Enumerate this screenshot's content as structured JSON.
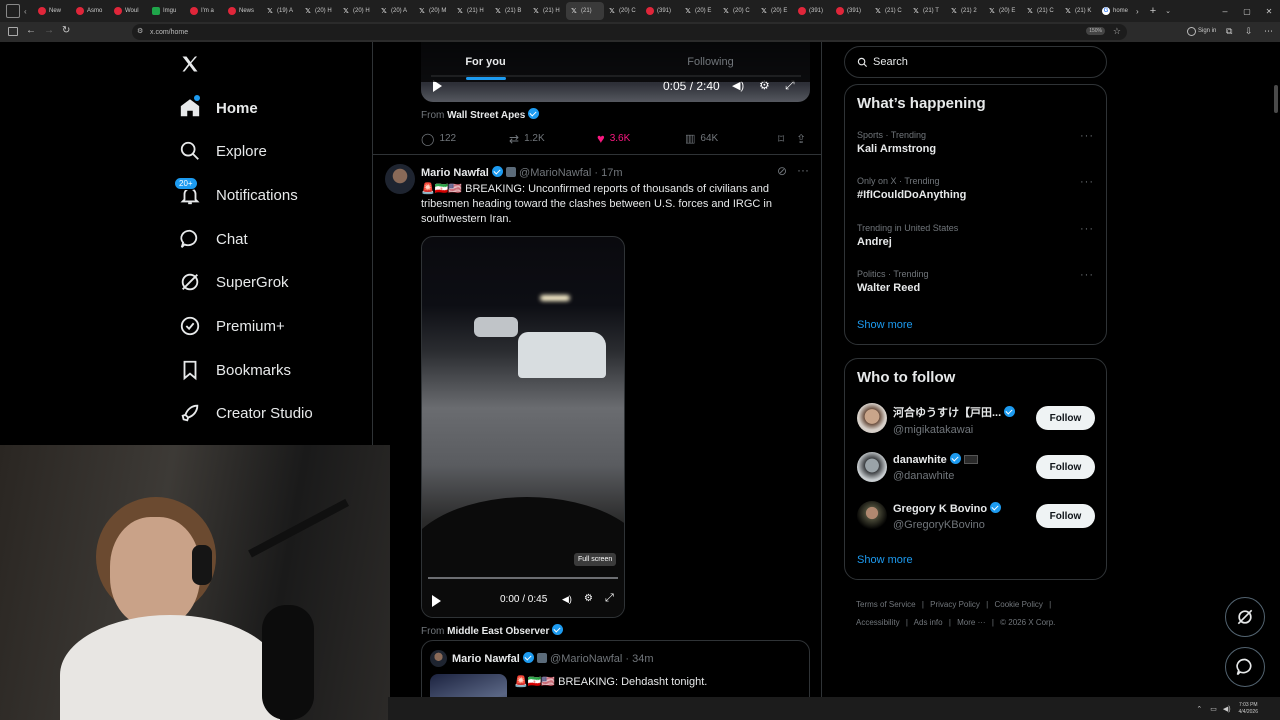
{
  "browser": {
    "tabs": [
      {
        "label": "New",
        "icon": "red-circle"
      },
      {
        "label": "Asmo",
        "icon": "red-circle"
      },
      {
        "label": "Woul",
        "icon": "red-circle"
      },
      {
        "label": "Imgu",
        "icon": "green-square"
      },
      {
        "label": "I'm a",
        "icon": "red-circle"
      },
      {
        "label": "News",
        "icon": "red-circle"
      },
      {
        "label": "(19) A",
        "icon": "x-logo"
      },
      {
        "label": "(20) H",
        "icon": "x-logo"
      },
      {
        "label": "(20) H",
        "icon": "x-logo"
      },
      {
        "label": "(20) A",
        "icon": "x-logo"
      },
      {
        "label": "(20) M",
        "icon": "x-logo"
      },
      {
        "label": "(21) H",
        "icon": "x-logo"
      },
      {
        "label": "(21) B",
        "icon": "x-logo"
      },
      {
        "label": "(21) H",
        "icon": "x-logo"
      },
      {
        "label": "(21)",
        "icon": "x-logo",
        "active": true
      },
      {
        "label": "(20) C",
        "icon": "x-logo"
      },
      {
        "label": "(391)",
        "icon": "red-circle"
      },
      {
        "label": "(20) E",
        "icon": "x-logo"
      },
      {
        "label": "(20) C",
        "icon": "x-logo"
      },
      {
        "label": "(20) E",
        "icon": "x-logo"
      },
      {
        "label": "(391)",
        "icon": "red-circle"
      },
      {
        "label": "(391)",
        "icon": "red-circle"
      },
      {
        "label": "(21) C",
        "icon": "x-logo"
      },
      {
        "label": "(21) T",
        "icon": "x-logo"
      },
      {
        "label": "(21) 2",
        "icon": "x-logo"
      },
      {
        "label": "(20) E",
        "icon": "x-logo"
      },
      {
        "label": "(21) C",
        "icon": "x-logo"
      },
      {
        "label": "(21) K",
        "icon": "x-logo"
      },
      {
        "label": "home",
        "icon": "g-logo"
      }
    ],
    "url": "x.com/home",
    "zoom": "150%",
    "sign_in": "Sign in"
  },
  "nav": {
    "items": [
      {
        "label": "Home",
        "icon": "home-icon",
        "active": true
      },
      {
        "label": "Explore",
        "icon": "search-icon"
      },
      {
        "label": "Notifications",
        "icon": "bell-icon",
        "badge": "20+"
      },
      {
        "label": "Chat",
        "icon": "chat-icon"
      },
      {
        "label": "SuperGrok",
        "icon": "grok-icon"
      },
      {
        "label": "Premium+",
        "icon": "premium-icon"
      },
      {
        "label": "Bookmarks",
        "icon": "bookmark-icon"
      },
      {
        "label": "Creator Studio",
        "icon": "rocket-icon"
      }
    ]
  },
  "timeline": {
    "tabs": [
      "For you",
      "Following"
    ],
    "prev_post": {
      "video_time": "0:05 / 2:40",
      "from_label": "From",
      "from_source": "Wall Street Apes",
      "replies": "122",
      "reposts": "1.2K",
      "likes": "3.6K",
      "views": "64K"
    },
    "post": {
      "author": "Mario Nawfal",
      "handle": "@MarioNawfal",
      "time": "· 17m",
      "text": "🚨🇮🇷🇺🇸 BREAKING: Unconfirmed reports of thousands of civilians and tribesmen heading toward the clashes between U.S. forces and IRGC in southwestern Iran.",
      "tooltip": "Full screen",
      "video_time": "0:00 / 0:45",
      "from_label": "From",
      "from_source": "Middle East Observer"
    },
    "quote": {
      "author": "Mario Nawfal",
      "handle": "@MarioNawfal",
      "time": "· 34m",
      "text": "🚨🇮🇷🇺🇸 BREAKING: Dehdasht tonight."
    }
  },
  "sidebar": {
    "search_placeholder": "Search",
    "happening": {
      "title": "What’s happening",
      "trends": [
        {
          "category": "Sports · Trending",
          "name": "Kali Armstrong"
        },
        {
          "category": "Only on X · Trending",
          "name": "#IfICouldDoAnything"
        },
        {
          "category": "Trending in United States",
          "name": "Andrej"
        },
        {
          "category": "Politics · Trending",
          "name": "Walter Reed"
        }
      ],
      "show_more": "Show more"
    },
    "who_to_follow": {
      "title": "Who to follow",
      "accounts": [
        {
          "name": "河合ゆうすけ【戸田...",
          "handle": "@migikatakawai",
          "button": "Follow"
        },
        {
          "name": "danawhite",
          "handle": "@danawhite",
          "button": "Follow"
        },
        {
          "name": "Gregory K Bovino",
          "handle": "@GregoryKBovino",
          "button": "Follow"
        }
      ],
      "show_more": "Show more"
    },
    "footer": [
      "Terms of Service",
      "Privacy Policy",
      "Cookie Policy",
      "Accessibility",
      "Ads info",
      "More ···",
      "© 2026 X Corp."
    ]
  },
  "taskbar": {
    "time": "7:03 PM",
    "date": "4/4/2026"
  },
  "colors": {
    "accent": "#1d9bf0",
    "like": "#f91880",
    "background": "#000000",
    "border": "#2f3336"
  }
}
